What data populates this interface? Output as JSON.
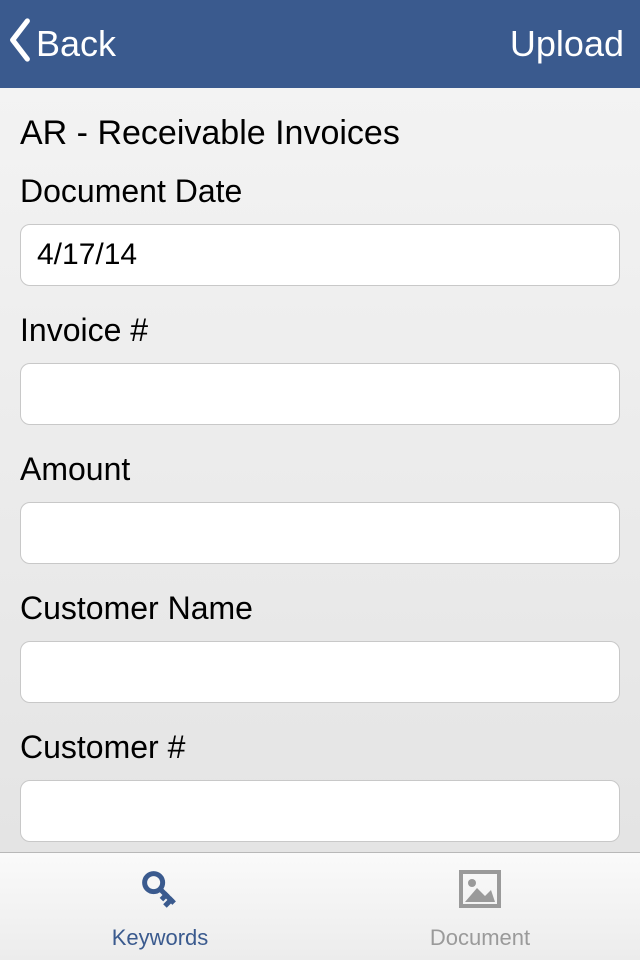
{
  "header": {
    "back_label": "Back",
    "upload_label": "Upload"
  },
  "page": {
    "title": "AR - Receivable Invoices"
  },
  "fields": {
    "document_date": {
      "label": "Document Date",
      "value": "4/17/14"
    },
    "invoice_number": {
      "label": "Invoice #",
      "value": ""
    },
    "amount": {
      "label": "Amount",
      "value": ""
    },
    "customer_name": {
      "label": "Customer Name",
      "value": ""
    },
    "customer_number": {
      "label": "Customer #",
      "value": ""
    }
  },
  "tabs": {
    "keywords": {
      "label": "Keywords"
    },
    "document": {
      "label": "Document"
    }
  },
  "colors": {
    "primary": "#3a5a8e",
    "inactive": "#9a9a9a"
  }
}
